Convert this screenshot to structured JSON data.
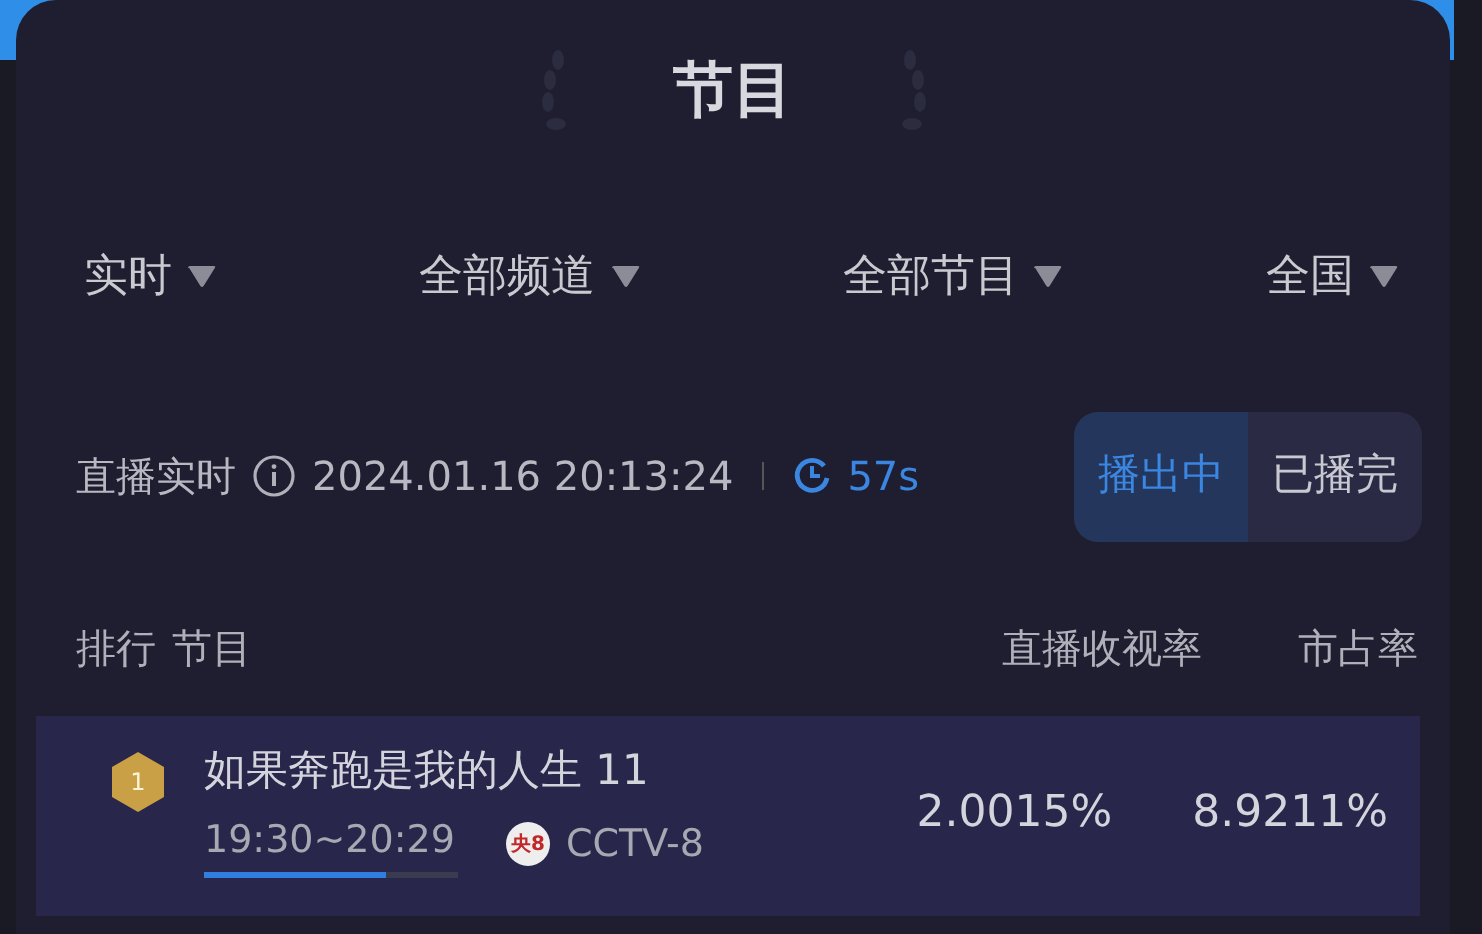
{
  "title": "节目",
  "filters": [
    {
      "label": "实时"
    },
    {
      "label": "全部频道"
    },
    {
      "label": "全部节目"
    },
    {
      "label": "全国"
    }
  ],
  "status": {
    "label": "直播实时",
    "timestamp": "2024.01.16 20:13:24",
    "countdown": "57s"
  },
  "segments": [
    {
      "label": "播出中",
      "selected": true
    },
    {
      "label": "已播完",
      "selected": false
    }
  ],
  "table": {
    "columns": [
      "排行",
      "节目",
      "直播收视率",
      "市占率"
    ],
    "rows": [
      {
        "rank": "1",
        "program": "如果奔跑是我的人生 11",
        "time": "19:30~20:29",
        "level": 0.72,
        "channel_logo": "央8",
        "channel": "CCTV-8",
        "rating": "2.0015%",
        "share": "8.9211%"
      }
    ]
  }
}
